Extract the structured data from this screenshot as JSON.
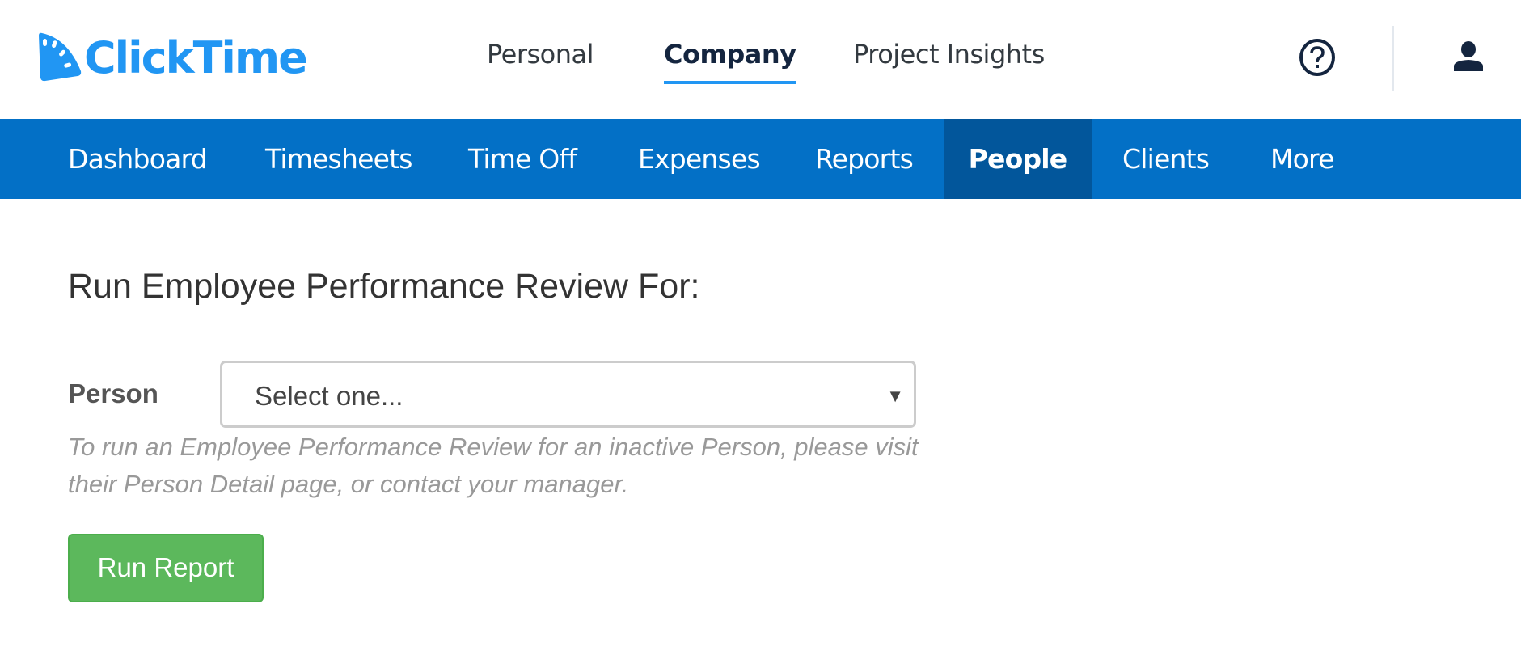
{
  "header": {
    "logo_text": "ClickTime",
    "top_nav": [
      {
        "label": "Personal",
        "active": false
      },
      {
        "label": "Company",
        "active": true
      },
      {
        "label": "Project Insights",
        "active": false
      }
    ],
    "help_icon": "help-circle-icon",
    "user_icon": "user-icon"
  },
  "main_nav": [
    {
      "label": "Dashboard",
      "active": false
    },
    {
      "label": "Timesheets",
      "active": false
    },
    {
      "label": "Time Off",
      "active": false
    },
    {
      "label": "Expenses",
      "active": false
    },
    {
      "label": "Reports",
      "active": false
    },
    {
      "label": "People",
      "active": true
    },
    {
      "label": "Clients",
      "active": false
    },
    {
      "label": "More",
      "active": false
    }
  ],
  "form": {
    "title": "Run Employee Performance Review For:",
    "person_label": "Person",
    "person_select_value": "Select one...",
    "help_text": "To run an Employee Performance Review for an inactive Person, please visit their Person Detail page, or contact your manager.",
    "run_button": "Run Report"
  },
  "colors": {
    "brand": "#2196f3",
    "nav_bg": "#0370c6",
    "nav_active": "#02569b",
    "button": "#5cb85c"
  }
}
